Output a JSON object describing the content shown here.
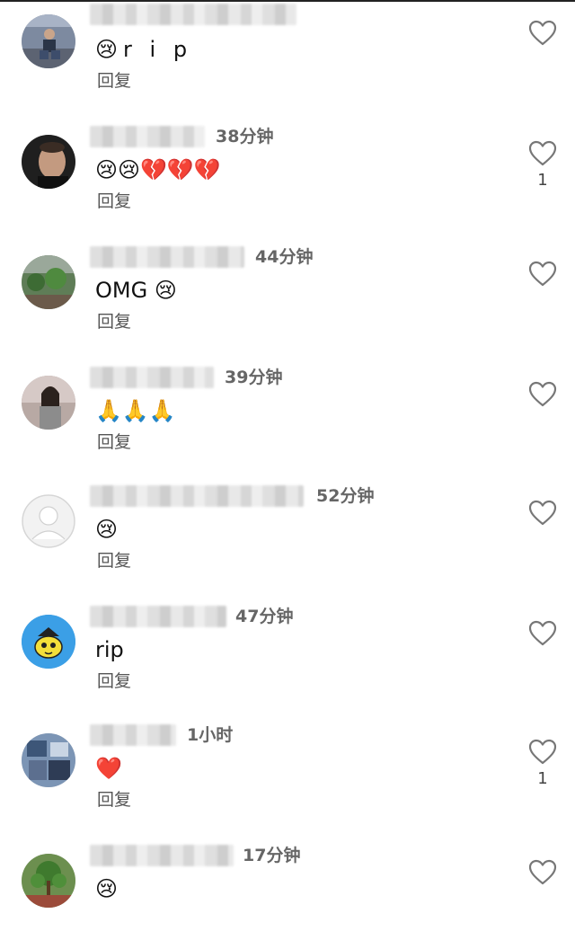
{
  "comments": [
    {
      "avatar": "avatar-photo-person-sitting",
      "time": "",
      "text": "😢r i p",
      "reply": "回复",
      "likes": ""
    },
    {
      "avatar": "avatar-photo-man-portrait",
      "time": "38分钟",
      "text": "😢😢💔💔💔",
      "reply": "回复",
      "likes": "1"
    },
    {
      "avatar": "avatar-photo-garden",
      "time": "44分钟",
      "text": "OMG 😢",
      "reply": "回复",
      "likes": ""
    },
    {
      "avatar": "avatar-photo-woman",
      "time": "39分钟",
      "text": "🙏🙏🙏",
      "reply": "回复",
      "likes": ""
    },
    {
      "avatar": "avatar-default-placeholder",
      "time": "52分钟",
      "text": "😢",
      "reply": "回复",
      "likes": ""
    },
    {
      "avatar": "avatar-cartoon-fish",
      "time": "47分钟",
      "text": "rip",
      "reply": "回复",
      "likes": ""
    },
    {
      "avatar": "avatar-photo-collage",
      "time": "1小时",
      "text": "❤️",
      "reply": "回复",
      "likes": "1"
    },
    {
      "avatar": "avatar-photo-bonsai",
      "time": "17分钟",
      "text": "😢",
      "reply": "",
      "likes": ""
    }
  ],
  "icons": {
    "like": "heart-outline-icon"
  },
  "colors": {
    "heart_outline": "#777777",
    "text": "#111111",
    "meta": "#666666"
  }
}
